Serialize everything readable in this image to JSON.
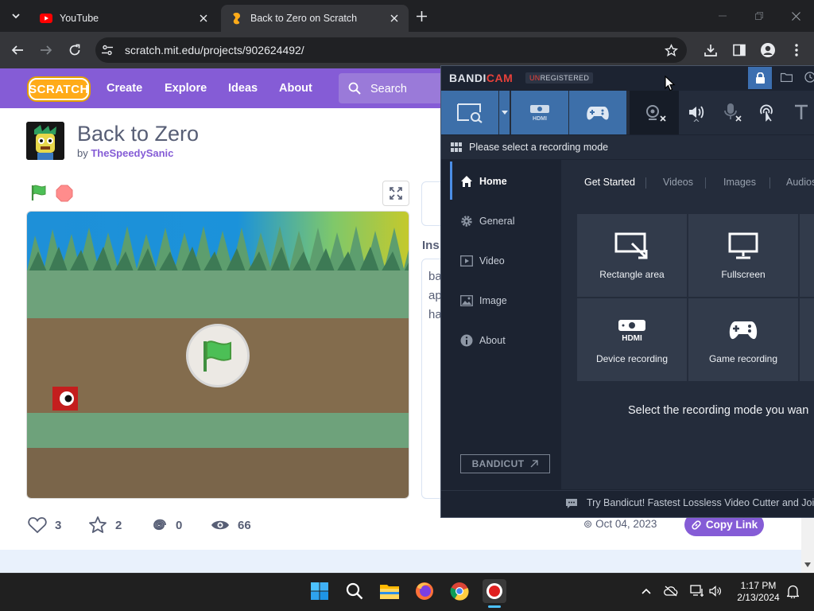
{
  "browser": {
    "tabs": [
      {
        "title": "YouTube",
        "icon": "youtube-icon",
        "active": false
      },
      {
        "title": "Back to Zero on Scratch",
        "icon": "scratch-icon",
        "active": true
      }
    ],
    "url": "scratch.mit.edu/projects/902624492/"
  },
  "scratch": {
    "logo": "SCRATCH",
    "nav": [
      "Create",
      "Explore",
      "Ideas",
      "About"
    ],
    "search_placeholder": "Search",
    "project": {
      "title": "Back to Zero",
      "by_label": "by",
      "author": "TheSpeedySanic"
    },
    "instructions_label": "Ins",
    "instructions_lines": [
      "ba",
      "ap",
      "ha"
    ],
    "stats": {
      "loves": "3",
      "favorites": "2",
      "remixes": "0",
      "views": "66"
    },
    "date": "Oct 04, 2023",
    "copy_link": "Copy Link"
  },
  "bandicam": {
    "logo_band": "BANDI",
    "logo_cam": "CAM",
    "unregistered_u": "UN",
    "unregistered_rest": "REGISTERED",
    "hint": "Please select a recording mode",
    "side_nav": [
      {
        "label": "Home",
        "icon": "home-icon",
        "active": true
      },
      {
        "label": "General",
        "icon": "gear-icon",
        "active": false
      },
      {
        "label": "Video",
        "icon": "video-icon",
        "active": false
      },
      {
        "label": "Image",
        "icon": "image-icon",
        "active": false
      },
      {
        "label": "About",
        "icon": "info-icon",
        "active": false
      }
    ],
    "bandicut_label": "BANDICUT",
    "tabs": [
      "Get Started",
      "Videos",
      "Images",
      "Audios"
    ],
    "tiles": [
      {
        "label": "Rectangle area",
        "icon": "rectangle-area-icon"
      },
      {
        "label": "Fullscreen",
        "icon": "monitor-icon"
      },
      {
        "label": "Device recording",
        "icon": "hdmi-icon"
      },
      {
        "label": "Game recording",
        "icon": "gamepad-icon"
      }
    ],
    "hdmi_text": "HDMI",
    "select_prompt": "Select the recording mode you wan",
    "footer": "Try Bandicut! Fastest Lossless Video Cutter and Joiner"
  },
  "taskbar": {
    "time": "1:17 PM",
    "date": "2/13/2024"
  },
  "colors": {
    "scratch_purple": "#855cd6",
    "bandicam_bg": "#1c2331",
    "bandicam_blue": "#3d6fa9",
    "chrome_dark": "#202124"
  }
}
